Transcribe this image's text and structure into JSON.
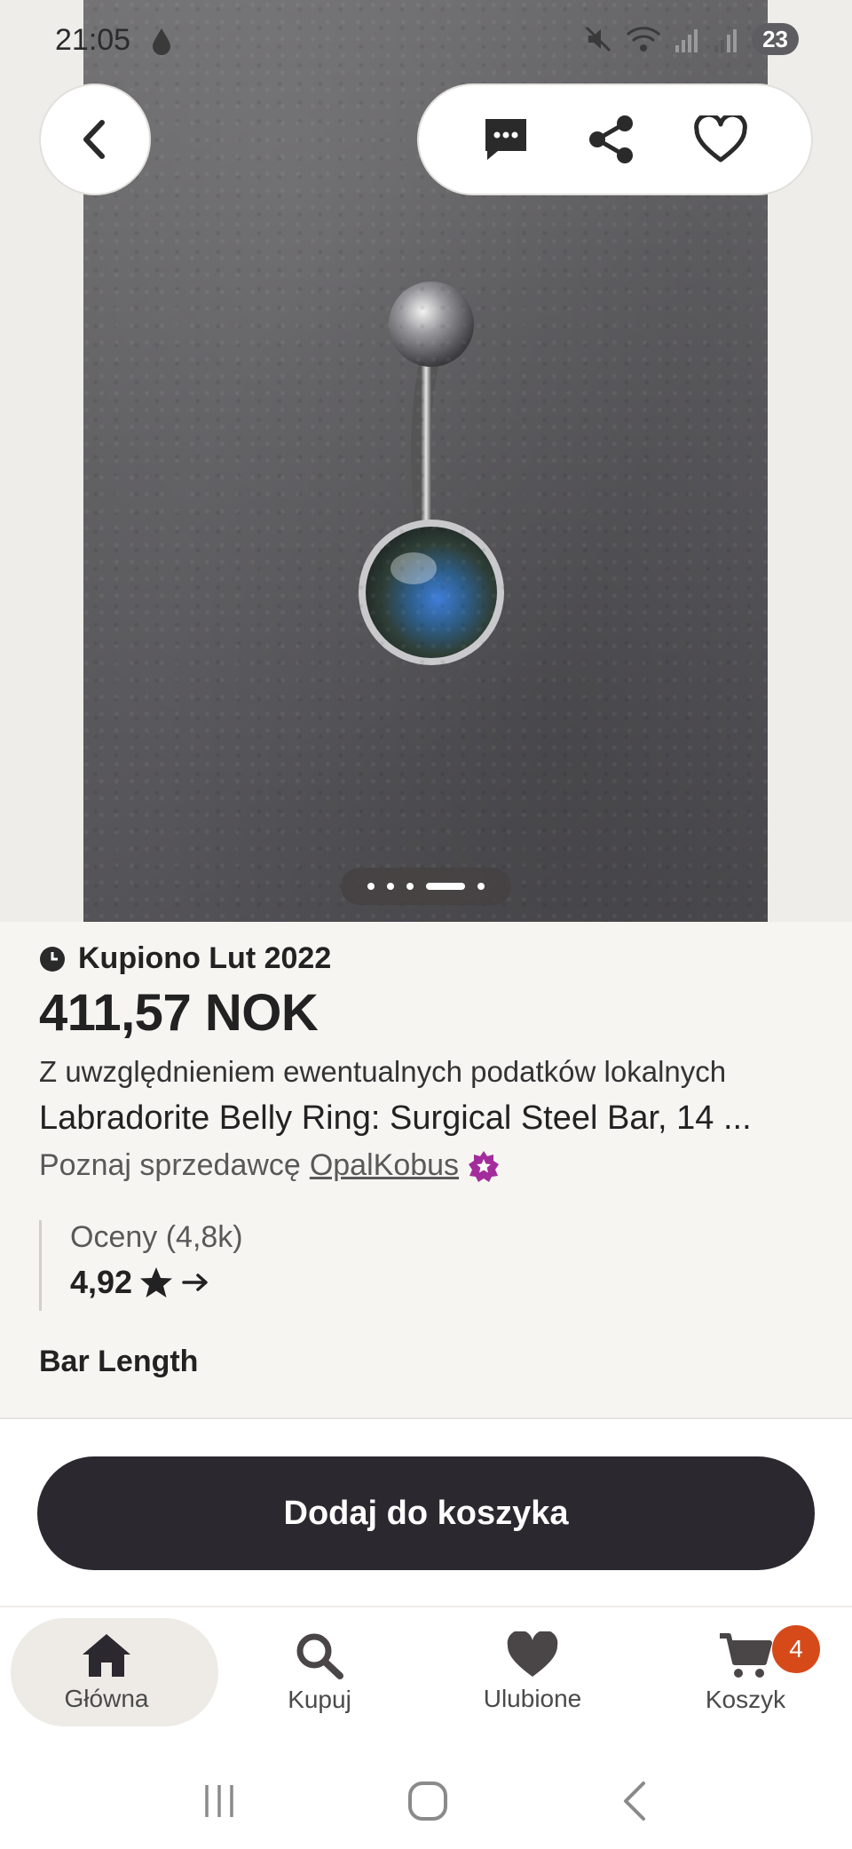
{
  "status_bar": {
    "time": "21:05",
    "battery": "23"
  },
  "hero": {
    "carousel_dots": 5,
    "active_dot_index": 3
  },
  "product": {
    "bought_label": "Kupiono Lut 2022",
    "price": "411,57 NOK",
    "tax_note": "Z uwzględnieniem ewentualnych podatków lokalnych",
    "title": "Labradorite Belly Ring: Surgical Steel Bar, 14 ...",
    "seller_prefix": "Poznaj sprzedawcę",
    "seller_name": "OpalKobus"
  },
  "reviews": {
    "label": "Oceny (4,8k)",
    "rating": "4,92"
  },
  "section": {
    "bar_length_title": "Bar Length"
  },
  "cart": {
    "button_label": "Dodaj do koszyka"
  },
  "nav": {
    "items": [
      {
        "label": "Główna",
        "icon": "home-icon"
      },
      {
        "label": "Kupuj",
        "icon": "search-icon"
      },
      {
        "label": "Ulubione",
        "icon": "heart-icon"
      },
      {
        "label": "Koszyk",
        "icon": "cart-icon"
      }
    ],
    "cart_badge": "4"
  },
  "colors": {
    "primary_button": "#2c2830",
    "badge": "#d64a1a",
    "star_seller": "#a32c9c"
  }
}
